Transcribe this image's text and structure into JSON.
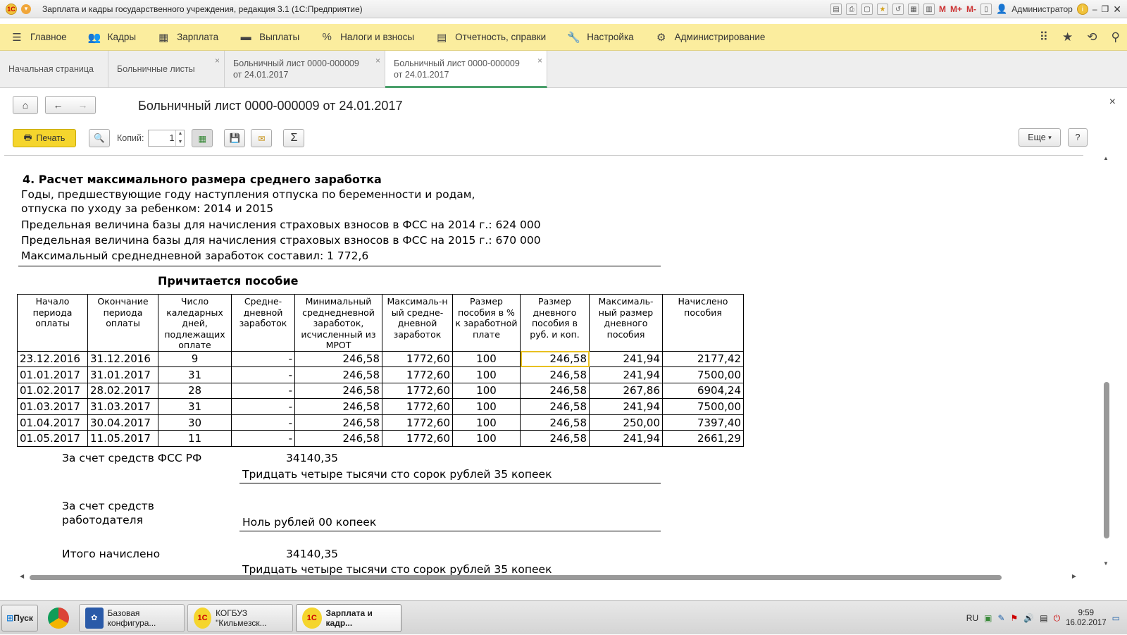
{
  "window": {
    "title": "Зарплата и кадры государственного учреждения, редакция 3.1 (1С:Предприятие)",
    "user": "Администратор",
    "m_labels": [
      "M",
      "M+",
      "M-"
    ]
  },
  "menu": {
    "items": [
      {
        "label": "Главное",
        "icon": "hamburger-icon"
      },
      {
        "label": "Кадры",
        "icon": "people-icon"
      },
      {
        "label": "Зарплата",
        "icon": "calculator-icon"
      },
      {
        "label": "Выплаты",
        "icon": "wallet-icon"
      },
      {
        "label": "Налоги и взносы",
        "icon": "percent-icon"
      },
      {
        "label": "Отчетность, справки",
        "icon": "report-icon"
      },
      {
        "label": "Настройка",
        "icon": "wrench-icon"
      },
      {
        "label": "Администрирование",
        "icon": "gear-icon"
      }
    ]
  },
  "tabs": [
    {
      "line1": "Начальная страница",
      "line2": ""
    },
    {
      "line1": "Больничные листы",
      "line2": ""
    },
    {
      "line1": "Больничный лист 0000-000009",
      "line2": "от 24.01.2017"
    },
    {
      "line1": "Больничный лист 0000-000009",
      "line2": "от 24.01.2017"
    }
  ],
  "document": {
    "title": "Больничный лист 0000-000009 от 24.01.2017"
  },
  "toolbar": {
    "print_label": "Печать",
    "copies_label": "Копий:",
    "copies_value": "1",
    "more_label": "Еще",
    "help_label": "?",
    "sum_label": "Σ"
  },
  "report": {
    "section_title": "4. Расчет максимального размера среднего заработка",
    "years_line1": "Годы, предшествующие году наступления отпуска по беременности и родам,",
    "years_line2": "отпуска по уходу за ребенком: 2014 и 2015",
    "limit_2014": "Предельная величина базы для начисления страховых взносов в ФСС на 2014 г.: 624 000",
    "limit_2015": "Предельная величина базы для начисления страховых взносов в ФСС на 2015 г.: 670 000",
    "max_daily": "Максимальный среднедневной заработок составил: 1 772,6",
    "due_title": "Причитается пособие",
    "columns": [
      "Начало периода оплаты",
      "Окончание периода оплаты",
      "Число каледарных дней, подлежащих оплате",
      "Средне-дневной заработок",
      "Минимальный среднедневной заработок, исчисленный из МРОТ",
      "Максималь-н ый средне-дневной заработок",
      "Размер пособия в % к заработной плате",
      "Размер дневного пособия в руб. и коп.",
      "Максималь-ный размер дневного пособия",
      "Начислено пособия"
    ],
    "rows": [
      [
        "23.12.2016",
        "31.12.2016",
        "9",
        "-",
        "246,58",
        "1772,60",
        "100",
        "246,58",
        "241,94",
        "2177,42"
      ],
      [
        "01.01.2017",
        "31.01.2017",
        "31",
        "-",
        "246,58",
        "1772,60",
        "100",
        "246,58",
        "241,94",
        "7500,00"
      ],
      [
        "01.02.2017",
        "28.02.2017",
        "28",
        "-",
        "246,58",
        "1772,60",
        "100",
        "246,58",
        "267,86",
        "6904,24"
      ],
      [
        "01.03.2017",
        "31.03.2017",
        "31",
        "-",
        "246,58",
        "1772,60",
        "100",
        "246,58",
        "241,94",
        "7500,00"
      ],
      [
        "01.04.2017",
        "30.04.2017",
        "30",
        "-",
        "246,58",
        "1772,60",
        "100",
        "246,58",
        "250,00",
        "7397,40"
      ],
      [
        "01.05.2017",
        "11.05.2017",
        "11",
        "-",
        "246,58",
        "1772,60",
        "100",
        "246,58",
        "241,94",
        "2661,29"
      ]
    ],
    "fss_label": "За счет средств ФСС РФ",
    "fss_amount": "34140,35",
    "fss_words": "Тридцать четыре тысячи сто сорок рублей 35 копеек",
    "employer_label1": "За счет средств",
    "employer_label2": "работодателя",
    "employer_words": "Ноль рублей 00 копеек",
    "total_label": "Итого начислено",
    "total_amount": "34140,35",
    "total_words": "Тридцать четыре тысячи сто сорок рублей 35 копеек"
  },
  "taskbar": {
    "start_label": "Пуск",
    "apps": [
      {
        "label": "Базовая конфигура..."
      },
      {
        "label": "КОГБУЗ \"Кильмезск..."
      },
      {
        "label": "Зарплата и кадр..."
      }
    ],
    "lang": "RU",
    "time": "9:59",
    "date": "16.02.2017"
  }
}
